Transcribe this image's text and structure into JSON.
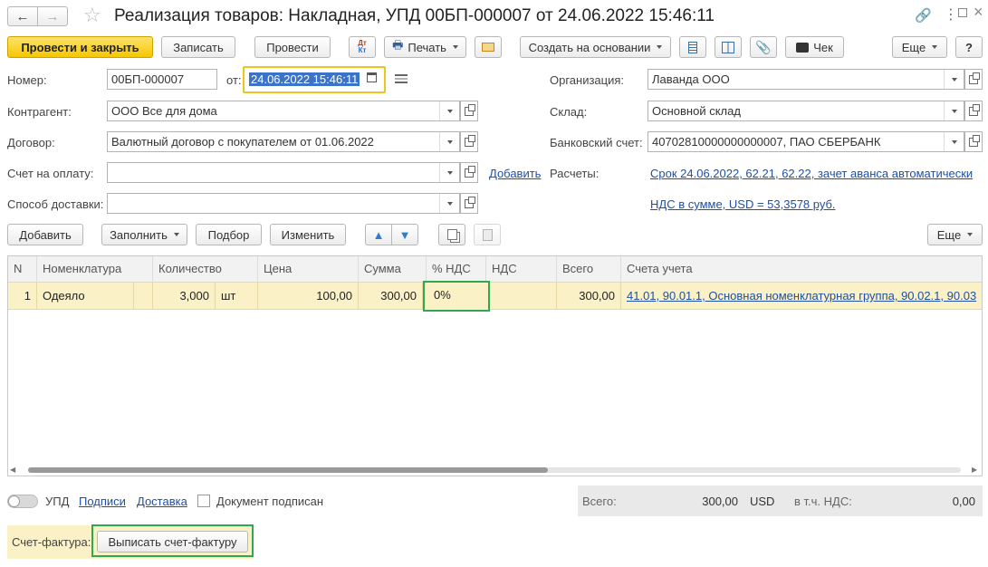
{
  "window": {
    "title": "Реализация товаров: Накладная, УПД 00БП-000007 от 24.06.2022 15:46:11"
  },
  "toolbar": {
    "post_close": "Провести и закрыть",
    "save": "Записать",
    "post": "Провести",
    "dtkt": "Дт Кт",
    "print": "Печать",
    "create_based": "Создать на основании",
    "check": "Чек",
    "more": "Еще",
    "help": "?"
  },
  "form": {
    "number_label": "Номер:",
    "number_value": "00БП-000007",
    "date_label": "от:",
    "date_value": "24.06.2022 15:46:11",
    "org_label": "Организация:",
    "org_value": "Лаванда ООО",
    "contractor_label": "Контрагент:",
    "contractor_value": "ООО Все для дома",
    "warehouse_label": "Склад:",
    "warehouse_value": "Основной склад",
    "contract_label": "Договор:",
    "contract_value": "Валютный договор с покупателем от 01.06.2022",
    "bank_label": "Банковский счет:",
    "bank_value": "40702810000000000007, ПАО СБЕРБАНК",
    "invoice_label": "Счет на оплату:",
    "invoice_value": "",
    "add_link": "Добавить",
    "settlements_label": "Расчеты:",
    "settlements_link": "Срок 24.06.2022, 62.21, 62.22, зачет аванса автоматически",
    "delivery_label": "Способ доставки:",
    "delivery_value": "",
    "vat_link": "НДС в сумме, USD = 53,3578 руб."
  },
  "table_toolbar": {
    "add": "Добавить",
    "fill": "Заполнить",
    "select": "Подбор",
    "change": "Изменить",
    "more": "Еще"
  },
  "table": {
    "headers": [
      "N",
      "Номенклатура",
      "Количество",
      "Цена",
      "Сумма",
      "% НДС",
      "НДС",
      "Всего",
      "Счета учета"
    ],
    "rows": [
      {
        "n": "1",
        "item": "Одеяло",
        "qty": "3,000",
        "unit": "шт",
        "price": "100,00",
        "sum": "300,00",
        "vat_rate": "0%",
        "vat": "",
        "total": "300,00",
        "accounts": "41.01, 90.01.1, Основная номенклатурная группа, 90.02.1, 90.03"
      }
    ]
  },
  "footer": {
    "upd_label": "УПД",
    "signatures_link": "Подписи",
    "delivery_link": "Доставка",
    "signed_label": "Документ подписан",
    "total_label": "Всего:",
    "total_value": "300,00",
    "currency": "USD",
    "vat_incl_label": "в т.ч. НДС:",
    "vat_incl_value": "0,00",
    "invoice_label": "Счет-фактура:",
    "invoice_button": "Выписать счет-фактуру"
  },
  "colors": {
    "accent_yellow": "#f5c700",
    "highlight_green": "#2fa84f",
    "row_selected": "#fbf1c7",
    "link_blue": "#1d4fa6"
  }
}
